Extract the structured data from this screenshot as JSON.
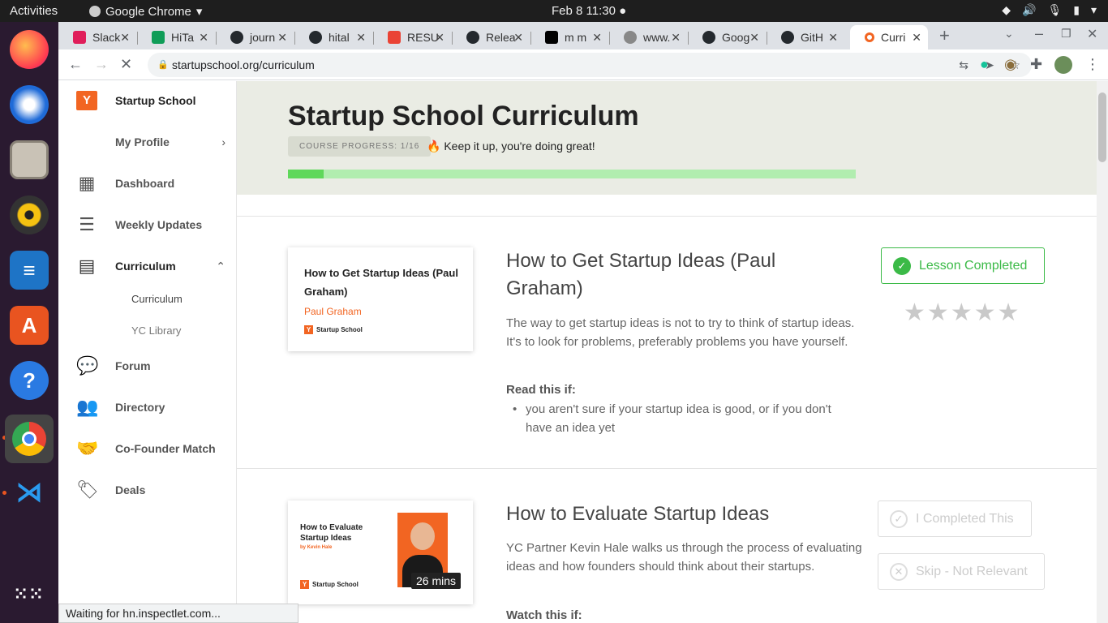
{
  "os": {
    "activities": "Activities",
    "app_name": "Google Chrome",
    "clock": "Feb 8  11:30"
  },
  "browser": {
    "tabs": [
      {
        "label": "Slack",
        "icon": "slack-icon",
        "color": "#e01e5a"
      },
      {
        "label": "HiTa",
        "icon": "sheets-icon",
        "color": "#0f9d58"
      },
      {
        "label": "journ",
        "icon": "github-icon",
        "color": "#24292e"
      },
      {
        "label": "hital",
        "icon": "github-icon",
        "color": "#24292e"
      },
      {
        "label": "RESU",
        "icon": "gmail-icon",
        "color": "#ea4335"
      },
      {
        "label": "Relea",
        "icon": "github-icon",
        "color": "#24292e"
      },
      {
        "label": "m m",
        "icon": "medium-icon",
        "color": "#000000"
      },
      {
        "label": "www.",
        "icon": "globe-icon",
        "color": "#777777"
      },
      {
        "label": "Goog",
        "icon": "github-icon",
        "color": "#24292e"
      },
      {
        "label": "GitH",
        "icon": "github-icon",
        "color": "#24292e"
      },
      {
        "label": "Curri",
        "icon": "yc-icon",
        "color": "#f26522"
      }
    ],
    "url": "startupschool.org/curriculum",
    "status": "Waiting for hn.inspectlet.com..."
  },
  "sidebar": {
    "brand": "Startup School",
    "items": [
      {
        "label": "My Profile"
      },
      {
        "label": "Dashboard"
      },
      {
        "label": "Weekly Updates"
      },
      {
        "label": "Curriculum"
      },
      {
        "label": "Curriculum"
      },
      {
        "label": "YC Library"
      },
      {
        "label": "Forum"
      },
      {
        "label": "Directory"
      },
      {
        "label": "Co-Founder Match"
      },
      {
        "label": "Deals"
      }
    ]
  },
  "page": {
    "title": "Startup School Curriculum",
    "progress_label": "COURSE PROGRESS: 1/16",
    "progress_fraction": 0.0625,
    "progress_message": "Keep it up, you're doing great!",
    "accent_color": "#f26522",
    "success_color": "#3bba47"
  },
  "lessons": [
    {
      "card_title": "How to Get Startup Ideas (Paul Graham)",
      "card_author": "Paul Graham",
      "card_brand": "Startup School",
      "title": "How to Get Startup Ideas (Paul Graham)",
      "description": "The way to get startup ideas is not to try to think of startup ideas. It's to look for problems, preferably problems you have yourself.",
      "if_label": "Read this if:",
      "bullets": [
        "you aren't sure if your startup idea is good, or if you don't have an idea yet"
      ],
      "status_button": "Lesson Completed",
      "rating": 0
    },
    {
      "card_title": "How to Evaluate Startup Ideas",
      "card_author": "by Kevin Hale",
      "card_brand": "Startup School",
      "duration": "26 mins",
      "title": "How to Evaluate Startup Ideas",
      "description": "YC Partner Kevin Hale walks us through the process of evaluating ideas and how founders should think about their startups.",
      "if_label": "Watch this if:",
      "complete_button": "I Completed This",
      "skip_button": "Skip - Not Relevant"
    }
  ]
}
